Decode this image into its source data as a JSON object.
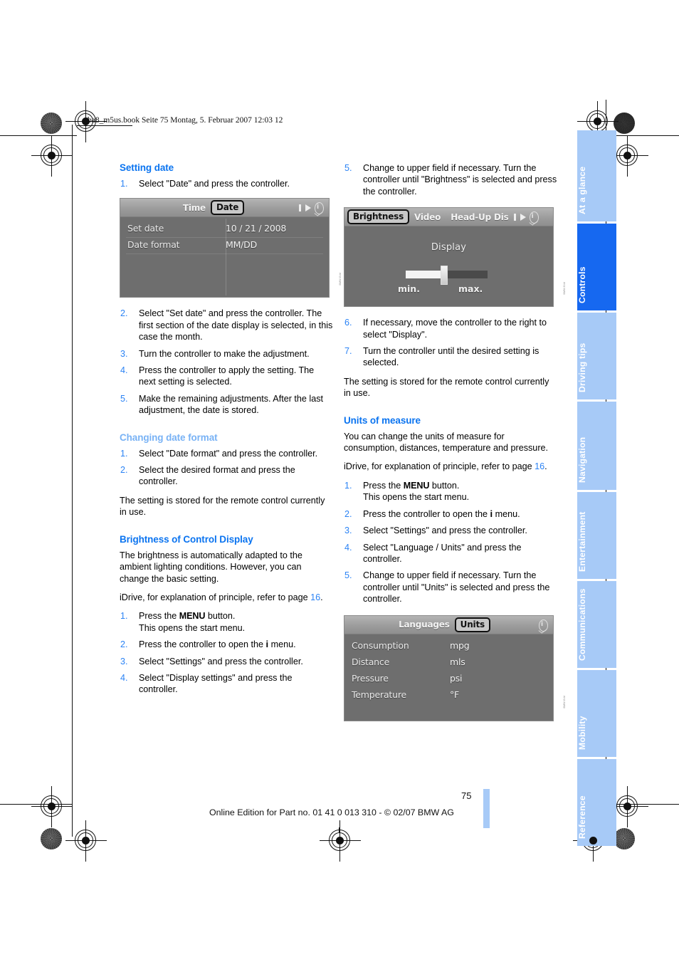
{
  "document": {
    "slug": "ba8_m5us.book  Seite 75  Montag, 5. Februar 2007  12:03 12",
    "page_number": "75",
    "footer": "Online Edition for Part no. 01 41 0 013 310 - © 02/07 BMW AG"
  },
  "sidebar": {
    "tabs": [
      {
        "label": "At a glance",
        "active": false
      },
      {
        "label": "Controls",
        "active": true
      },
      {
        "label": "Driving tips",
        "active": false
      },
      {
        "label": "Navigation",
        "active": false
      },
      {
        "label": "Entertainment",
        "active": false
      },
      {
        "label": "Communications",
        "active": false
      },
      {
        "label": "Mobility",
        "active": false
      },
      {
        "label": "Reference",
        "active": false
      }
    ],
    "colors": {
      "inactive": "#a7caf7",
      "active": "#1668f0",
      "label": "#ffffff"
    }
  },
  "colors": {
    "heading_blue": "#0b74f0",
    "heading_blue_light": "#78b2f5",
    "step_number_blue": "#2b83f5",
    "link_blue": "#2b83f5"
  },
  "left_column": {
    "setting_date": {
      "heading": "Setting date",
      "steps_before_image": [
        "Select \"Date\" and press the controller."
      ],
      "steps_after_image": [
        "Select \"Set date\" and press the controller. The first section of the date display is selected, in this case the month.",
        "Turn the controller to make the adjustment.",
        "Press the controller to apply the setting. The next setting is selected.",
        "Make the remaining adjustments. After the last adjustment, the date is stored."
      ],
      "step_numbers_before": [
        "1."
      ],
      "step_numbers_after": [
        "2.",
        "3.",
        "4.",
        "5."
      ],
      "screenshot": {
        "tabs": [
          {
            "label": "Time",
            "selected": false
          },
          {
            "label": "Date",
            "selected": true
          }
        ],
        "rows": [
          {
            "key": "Set date",
            "value": "10 / 21 / 2008"
          },
          {
            "key": "Date format",
            "value": "MM/DD"
          }
        ],
        "icons": [
          "right-arrow-icon",
          "up-down-info-icon"
        ]
      }
    },
    "changing_date_format": {
      "heading": "Changing date format",
      "step_numbers": [
        "1.",
        "2."
      ],
      "steps": [
        "Select \"Date format\" and press the controller.",
        "Select the desired format and press the controller."
      ],
      "note": "The setting is stored for the remote control currently in use."
    },
    "brightness": {
      "heading": "Brightness of Control Display",
      "intro": "The brightness is automatically adapted to the ambient lighting conditions. However, you can change the basic setting.",
      "idrive_ref_pre": "iDrive, for explanation of principle, refer to page ",
      "idrive_ref_page": "16",
      "idrive_ref_post": ".",
      "step_numbers": [
        "1.",
        "2.",
        "3.",
        "4."
      ],
      "steps": [
        {
          "pre": "Press the ",
          "kbd": "MENU",
          "post": " button.",
          "second_line": "This opens the start menu."
        },
        {
          "pre": "Press the controller to open the ",
          "icon": "i",
          "post": " menu."
        },
        {
          "text": "Select \"Settings\" and press the controller."
        },
        {
          "text": "Select \"Display settings\" and press the controller."
        }
      ]
    }
  },
  "right_column": {
    "brightness_continued": {
      "step_numbers_before": [
        "5."
      ],
      "steps_before_image": [
        "Change to upper field if necessary. Turn the controller until \"Brightness\" is selected and press the controller."
      ],
      "screenshot": {
        "tabs": [
          {
            "label": "Brightness",
            "selected": true
          },
          {
            "label": "Video",
            "selected": false
          },
          {
            "label": "Head-Up Dis",
            "selected": false
          }
        ],
        "panel_title": "Display",
        "slider": {
          "min_label": "min.",
          "max_label": "max.",
          "value_percent": 46
        },
        "icons": [
          "right-arrow-icon",
          "up-down-info-icon"
        ]
      },
      "step_numbers_after": [
        "6.",
        "7."
      ],
      "steps_after_image": [
        "If necessary, move the controller to the right to select \"Display\".",
        "Turn the controller until the desired setting is selected."
      ],
      "note": "The setting is stored for the remote control currently in use."
    },
    "units_of_measure": {
      "heading": "Units of measure",
      "intro": "You can change the units of measure for consumption, distances, temperature and pressure.",
      "idrive_ref_pre": "iDrive, for explanation of principle, refer to page ",
      "idrive_ref_page": "16",
      "idrive_ref_post": ".",
      "step_numbers": [
        "1.",
        "2.",
        "3.",
        "4.",
        "5."
      ],
      "steps": [
        {
          "pre": "Press the ",
          "kbd": "MENU",
          "post": " button.",
          "second_line": "This opens the start menu."
        },
        {
          "pre": "Press the controller to open the ",
          "icon": "i",
          "post": " menu."
        },
        {
          "text": "Select \"Settings\" and press the controller."
        },
        {
          "text": "Select \"Language / Units\" and press the controller."
        },
        {
          "text": "Change to upper field if necessary. Turn the controller until \"Units\" is selected and press the controller."
        }
      ],
      "screenshot": {
        "tabs": [
          {
            "label": "Languages",
            "selected": false
          },
          {
            "label": "Units",
            "selected": true
          }
        ],
        "rows": [
          {
            "key": "Consumption",
            "value": "mpg"
          },
          {
            "key": "Distance",
            "value": "mls"
          },
          {
            "key": "Pressure",
            "value": "psi"
          },
          {
            "key": "Temperature",
            "value": "°F"
          }
        ],
        "icons": [
          "up-down-info-icon"
        ]
      }
    }
  }
}
